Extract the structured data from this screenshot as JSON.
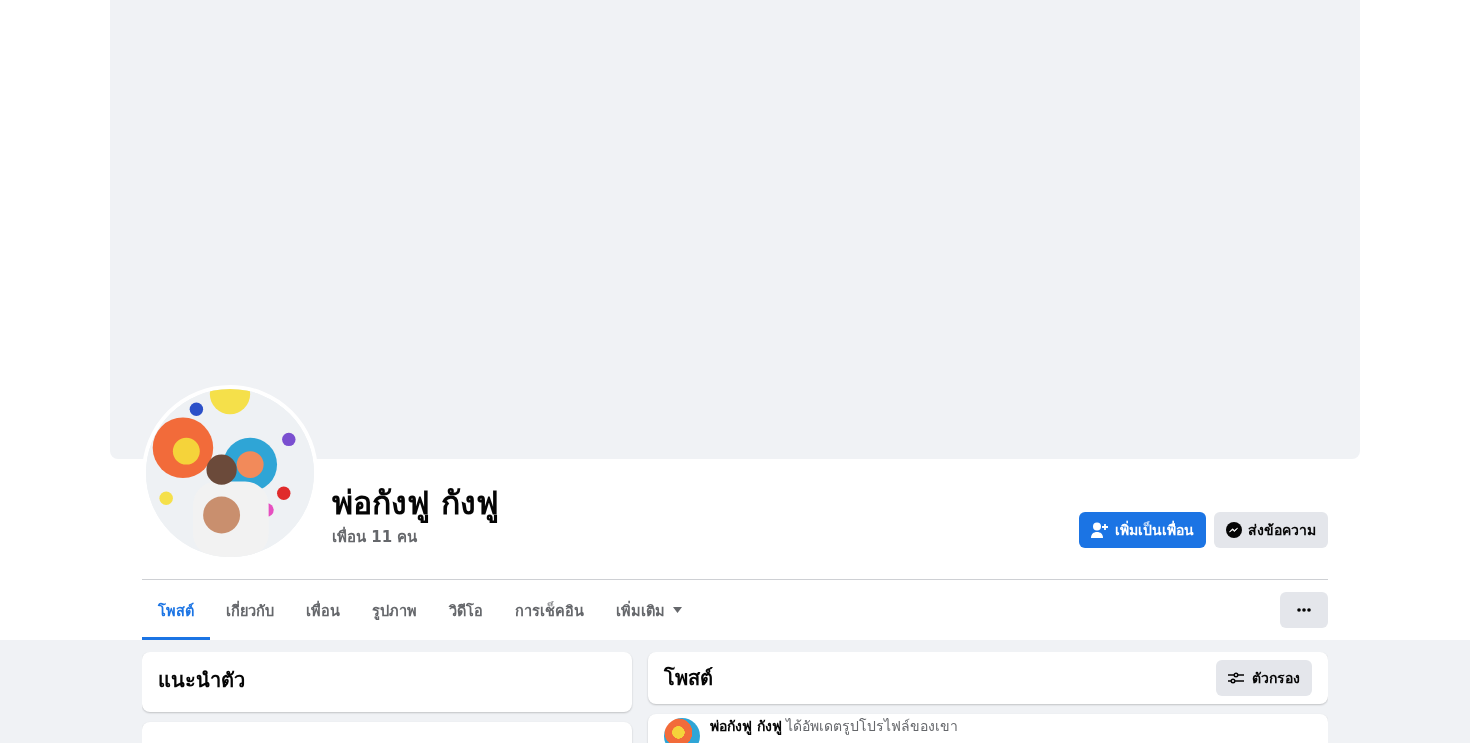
{
  "profile": {
    "name": "พ่อกังฟู กังฟู",
    "friends_count": "เพื่อน 11 คน"
  },
  "actions": [
    {
      "kind": "add_friend",
      "label": "เพิ่มเป็นเพื่อน"
    },
    {
      "kind": "message",
      "label": "ส่งข้อความ"
    }
  ],
  "tabs": [
    {
      "label": "โพสต์",
      "selected": true,
      "dropdown": false
    },
    {
      "label": "เกี่ยวกับ",
      "selected": false,
      "dropdown": false
    },
    {
      "label": "เพื่อน",
      "selected": false,
      "dropdown": false
    },
    {
      "label": "รูปภาพ",
      "selected": false,
      "dropdown": false
    },
    {
      "label": "วิดีโอ",
      "selected": false,
      "dropdown": false
    },
    {
      "label": "การเช็คอิน",
      "selected": false,
      "dropdown": false
    },
    {
      "label": "เพิ่มเติม",
      "selected": false,
      "dropdown": true
    }
  ],
  "intro": {
    "title": "แนะนำตัว"
  },
  "posts": {
    "title": "โพสต์",
    "filter_label": "ตัวกรอง"
  },
  "post": {
    "author": "พ่อกังฟู กังฟู",
    "action": "ได้อัพเดตรูปโปรไฟล์ของเขา"
  }
}
